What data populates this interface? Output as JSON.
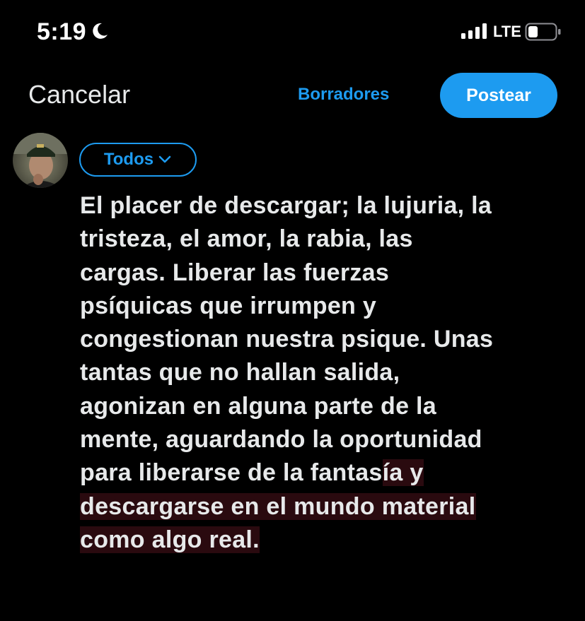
{
  "status_bar": {
    "time": "5:19",
    "network": "LTE",
    "icons": [
      "moon-icon",
      "signal-icon",
      "battery-icon"
    ]
  },
  "header": {
    "cancel_label": "Cancelar",
    "drafts_label": "Borradores",
    "post_label": "Postear"
  },
  "composer": {
    "audience_label": "Todos",
    "audience_icon": "chevron-down-icon",
    "text_lines": [
      "El placer de descargar; la lujuria, la",
      "tristeza, el amor, la rabia, las",
      "cargas. Liberar las fuerzas",
      "psíquicas que irrumpen y",
      "congestionan nuestra psique. Unas",
      "tantas que no hallan salida,",
      "agonizan en alguna parte de la",
      "mente, aguardando la oportunidad"
    ],
    "overflow_lines": {
      "line9_a": "para liberarse de la fantas",
      "line9_b": "ía y",
      "line10": "descargarse en el mundo material",
      "line11": "como algo real."
    },
    "over_limit_highlight_color": "#2a0a0f"
  },
  "colors": {
    "accent": "#1d9bf0",
    "background": "#000000",
    "text": "#e7e9ea"
  }
}
